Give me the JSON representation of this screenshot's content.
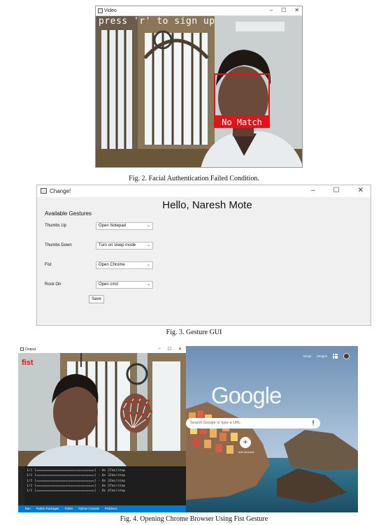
{
  "figure2": {
    "window_title": "Video",
    "overlay_text": "press 'r' to sign up",
    "status_label": "No Match",
    "caption": "Fig. 2. Facial Authentication Failed Condition."
  },
  "figure3": {
    "window_title": "Change!",
    "greeting": "Hello, Naresh Mote",
    "section_title": "Available Gestures",
    "gestures": [
      {
        "label": "Thumbs Up",
        "action": "Open Notepad"
      },
      {
        "label": "Thumbs Down",
        "action": "Turn on sleep mode"
      },
      {
        "label": "Fist",
        "action": "Open Chrome"
      },
      {
        "label": "Rock On",
        "action": "Open cmd"
      }
    ],
    "save_label": "Save",
    "caption": "Fig. 3. Gesture GUI"
  },
  "figure4": {
    "window_title": "Output",
    "gesture_text": "fist",
    "terminal_lines": [
      "1/1 [==============================] - 0s 27ms/step",
      "1/1 [==============================] - 0s 32ms/step",
      "1/1 [==============================] - 0s 32ms/step",
      "1/1 [==============================] - 0s 37ms/step",
      "1/1 [==============================] - 0s 47ms/step"
    ],
    "terminal_tabs": [
      "Run",
      "Python Packages",
      "TODO",
      "Python Console",
      "Problems"
    ],
    "browser": {
      "links": [
        "Gmail",
        "Images"
      ],
      "logo": "Google",
      "search_placeholder": "Search Google or type a URL",
      "shortcut_label": "Add shortcut"
    },
    "caption": "Fig. 4. Opening Chrome Browser Using Fist Gesture"
  }
}
